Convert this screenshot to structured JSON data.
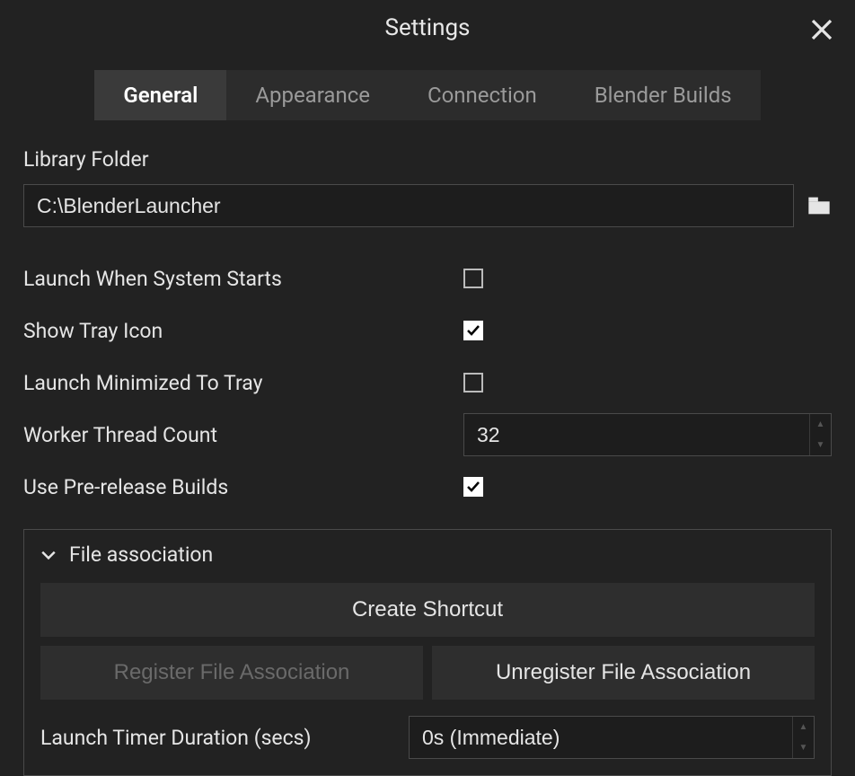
{
  "window": {
    "title": "Settings"
  },
  "tabs": [
    {
      "label": "General",
      "active": true
    },
    {
      "label": "Appearance",
      "active": false
    },
    {
      "label": "Connection",
      "active": false
    },
    {
      "label": "Blender Builds",
      "active": false
    }
  ],
  "general": {
    "libraryFolder": {
      "label": "Library Folder",
      "value": "C:\\BlenderLauncher"
    },
    "launchWhenSystemStarts": {
      "label": "Launch When System Starts",
      "checked": false
    },
    "showTrayIcon": {
      "label": "Show Tray Icon",
      "checked": true
    },
    "launchMinimizedToTray": {
      "label": "Launch Minimized To Tray",
      "checked": false
    },
    "workerThreadCount": {
      "label": "Worker Thread Count",
      "value": "32"
    },
    "usePreReleaseBuilds": {
      "label": "Use Pre-release Builds",
      "checked": true
    },
    "fileAssociation": {
      "title": "File association",
      "createShortcut": "Create Shortcut",
      "register": "Register File Association",
      "unregister": "Unregister File Association",
      "launchTimer": {
        "label": "Launch Timer Duration (secs)",
        "value": "0s (Immediate)"
      }
    }
  }
}
